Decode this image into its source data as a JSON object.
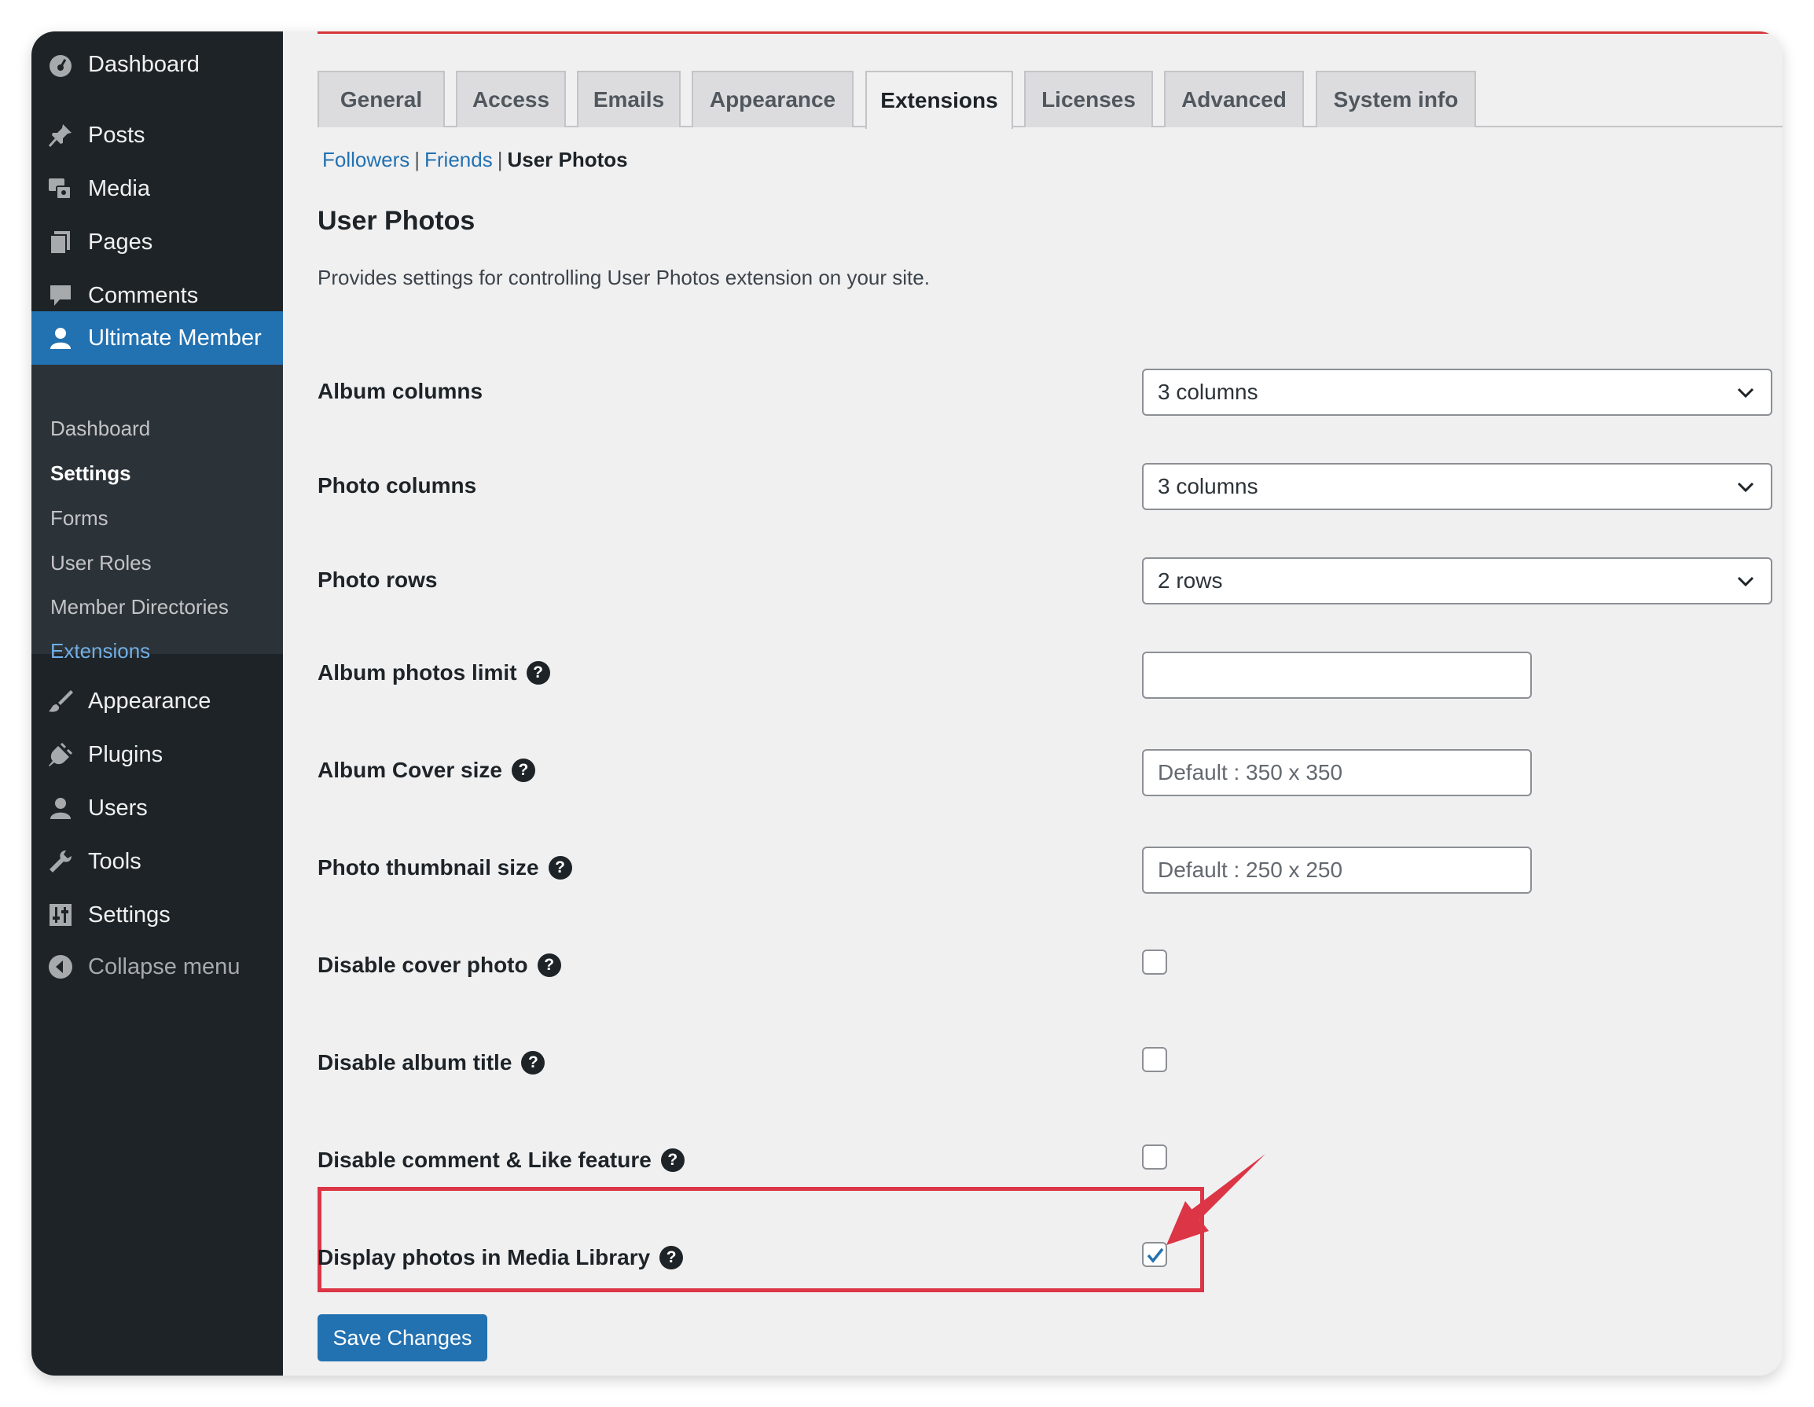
{
  "sidebar": {
    "menu": [
      {
        "label": "Dashboard",
        "icon": "dashboard-icon"
      },
      {
        "label": "Posts",
        "icon": "pushpin-icon"
      },
      {
        "label": "Media",
        "icon": "media-icon"
      },
      {
        "label": "Pages",
        "icon": "pages-icon"
      },
      {
        "label": "Comments",
        "icon": "comment-icon"
      },
      {
        "label": "Ultimate Member",
        "icon": "user-icon"
      }
    ],
    "submenu": [
      "Dashboard",
      "Settings",
      "Forms",
      "User Roles",
      "Member Directories",
      "Extensions"
    ],
    "menu2": [
      {
        "label": "Appearance",
        "icon": "paintbrush-icon"
      },
      {
        "label": "Plugins",
        "icon": "plug-icon"
      },
      {
        "label": "Users",
        "icon": "users-icon"
      },
      {
        "label": "Tools",
        "icon": "wrench-icon"
      },
      {
        "label": "Settings",
        "icon": "sliders-icon"
      },
      {
        "label": "Collapse menu",
        "icon": "collapse-arrow-icon"
      }
    ]
  },
  "tabs": [
    "General",
    "Access",
    "Emails",
    "Appearance",
    "Extensions",
    "Licenses",
    "Advanced",
    "System info"
  ],
  "active_tab": "Extensions",
  "subnav": {
    "followers": "Followers",
    "friends": "Friends",
    "sep": "|",
    "current": "User Photos"
  },
  "section": {
    "title": "User Photos",
    "description": "Provides settings for controlling User Photos extension on your site."
  },
  "fields": {
    "album_columns": {
      "label": "Album columns",
      "value": "3 columns"
    },
    "photo_columns": {
      "label": "Photo columns",
      "value": "3 columns"
    },
    "photo_rows": {
      "label": "Photo rows",
      "value": "2 rows"
    },
    "album_photos_limit": {
      "label": "Album photos limit",
      "value": ""
    },
    "album_cover_size": {
      "label": "Album Cover size",
      "placeholder": "Default : 350 x 350"
    },
    "photo_thumbnail_size": {
      "label": "Photo thumbnail size",
      "placeholder": "Default : 250 x 250"
    },
    "disable_cover_photo": {
      "label": "Disable cover photo",
      "checked": false
    },
    "disable_album_title": {
      "label": "Disable album title",
      "checked": false
    },
    "disable_comment_like": {
      "label": "Disable comment & Like feature",
      "checked": false
    },
    "display_in_media_library": {
      "label": "Display photos in Media Library",
      "checked": true
    }
  },
  "help_glyph": "?",
  "save_label": "Save Changes",
  "colors": {
    "sidebar": "#1d2327",
    "accent": "#2271b1",
    "highlight": "#dc3545",
    "background": "#f0f0f1"
  }
}
